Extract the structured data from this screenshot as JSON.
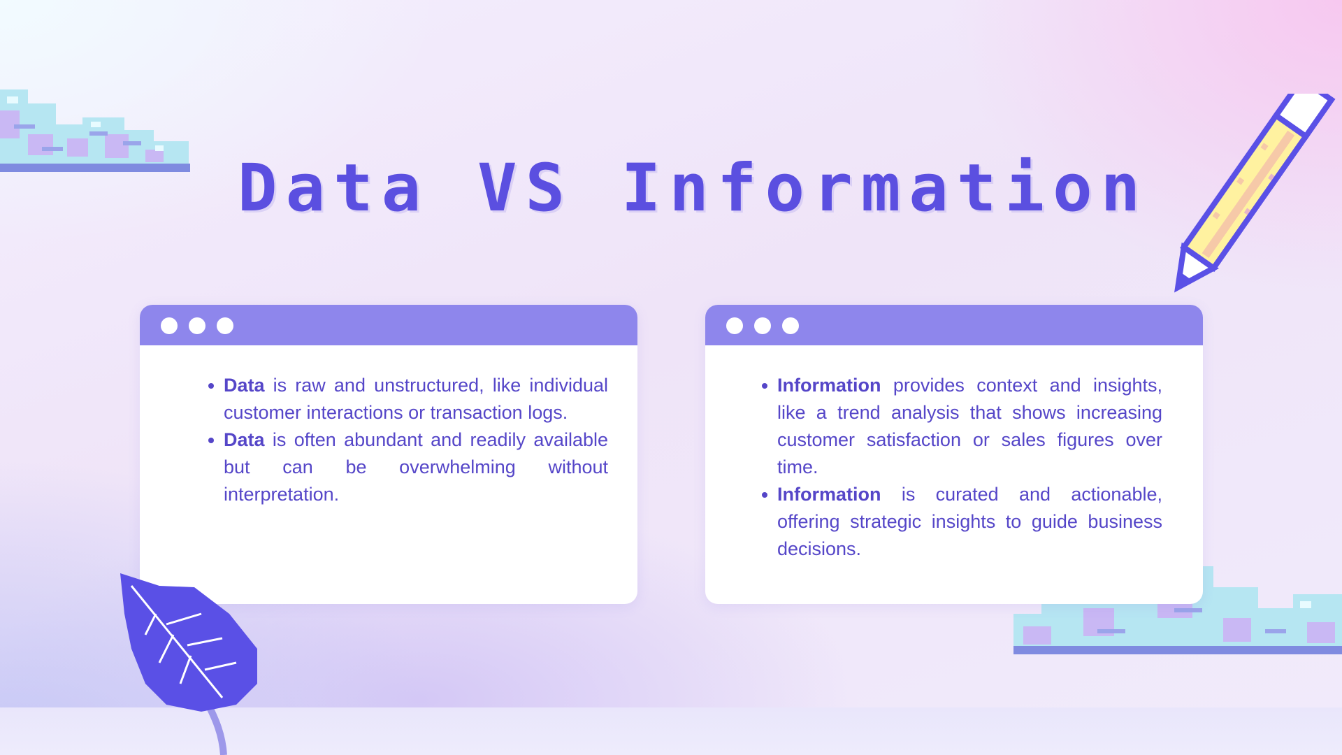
{
  "title": "Data VS Information",
  "colors": {
    "title": "#5b4fe0",
    "window_bar": "#8e86ec",
    "body_text": "#5546c8",
    "leaf": "#5a50e6",
    "cloud": "#b6e6f2",
    "pencil": "#fff2a0"
  },
  "windows": {
    "left": {
      "items": [
        {
          "keyword": "Data",
          "text": " is raw and unstructured, like individual customer interactions or transaction logs."
        },
        {
          "keyword": "Data",
          "text": " is often abundant and readily available but can be overwhelming without interpretation."
        }
      ]
    },
    "right": {
      "items": [
        {
          "keyword": "Information",
          "text": " provides context and insights, like a trend analysis that shows increasing customer satisfaction or sales figures over time."
        },
        {
          "keyword": "Information",
          "text": " is curated and actionable, offering strategic insights to guide business decisions."
        }
      ]
    }
  },
  "decorations": {
    "cloud_top_left": "cloud-icon",
    "cloud_bottom_right": "cloud-icon",
    "pencil": "pencil-icon",
    "leaf": "leaf-icon"
  }
}
